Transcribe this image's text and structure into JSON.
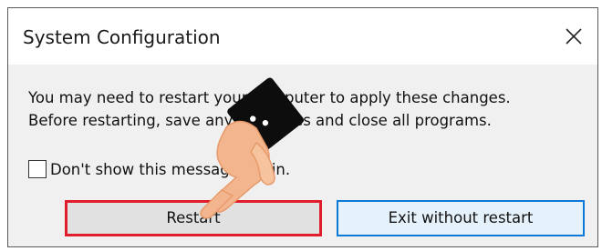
{
  "dialog": {
    "title": "System Configuration",
    "message_line1": "You may need to restart your computer to apply these changes.",
    "message_line2": "Before restarting, save any open files and close all programs.",
    "checkbox_label": "Don't show this message again.",
    "checkbox_checked": false,
    "restart_label": "Restart",
    "exit_label": "Exit without restart"
  },
  "colors": {
    "highlight_restart": "#e01e2b",
    "focus_exit": "#0a7ad6"
  },
  "icons": {
    "close": "close-icon",
    "pointer": "pointing-hand-icon"
  }
}
